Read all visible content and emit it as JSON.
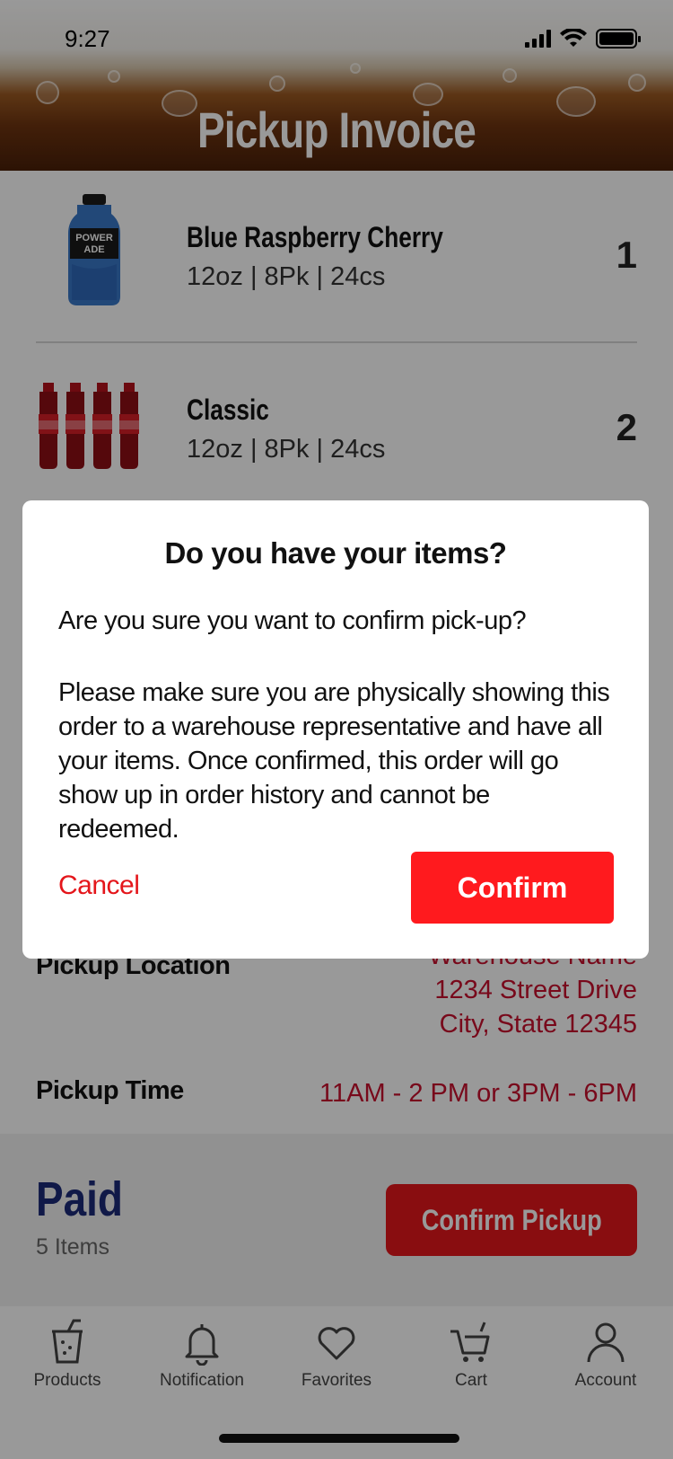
{
  "status_bar": {
    "time": "9:27"
  },
  "header": {
    "title": "Pickup Invoice"
  },
  "products": [
    {
      "name": "Blue Raspberry Cherry",
      "spec": "12oz  |  8Pk | 24cs",
      "qty": "1",
      "image": "powerade-bottle"
    },
    {
      "name": "Classic",
      "spec": "12oz  |  8Pk | 24cs",
      "qty": "2",
      "image": "coca-cola-8pack"
    }
  ],
  "pickup": {
    "location_label": "Pickup Location",
    "location_lines": [
      "Warehouse Name",
      "1234 Street Drive",
      "City, State 12345"
    ],
    "time_label": "Pickup Time",
    "time_value": "11AM - 2 PM or 3PM - 6PM"
  },
  "footer": {
    "status": "Paid",
    "items": "5 Items",
    "confirm_label": "Confirm Pickup"
  },
  "tabs": [
    {
      "label": "Products",
      "icon": "cup-icon"
    },
    {
      "label": "Notification",
      "icon": "bell-icon"
    },
    {
      "label": "Favorites",
      "icon": "heart-icon"
    },
    {
      "label": "Cart",
      "icon": "cart-icon"
    },
    {
      "label": "Account",
      "icon": "person-icon"
    }
  ],
  "dialog": {
    "title": "Do you have your items?",
    "question": "Are you sure you want to confirm pick-up?",
    "body": "Please make sure you are physically showing this order to a warehouse representative and have all your items. Once confirmed, this order will go show up in order history and cannot be redeemed.",
    "cancel_label": "Cancel",
    "confirm_label": "Confirm"
  },
  "colors": {
    "brand_red": "#e4161b",
    "paid_blue": "#1b2a78",
    "address_red": "#c8102e"
  }
}
